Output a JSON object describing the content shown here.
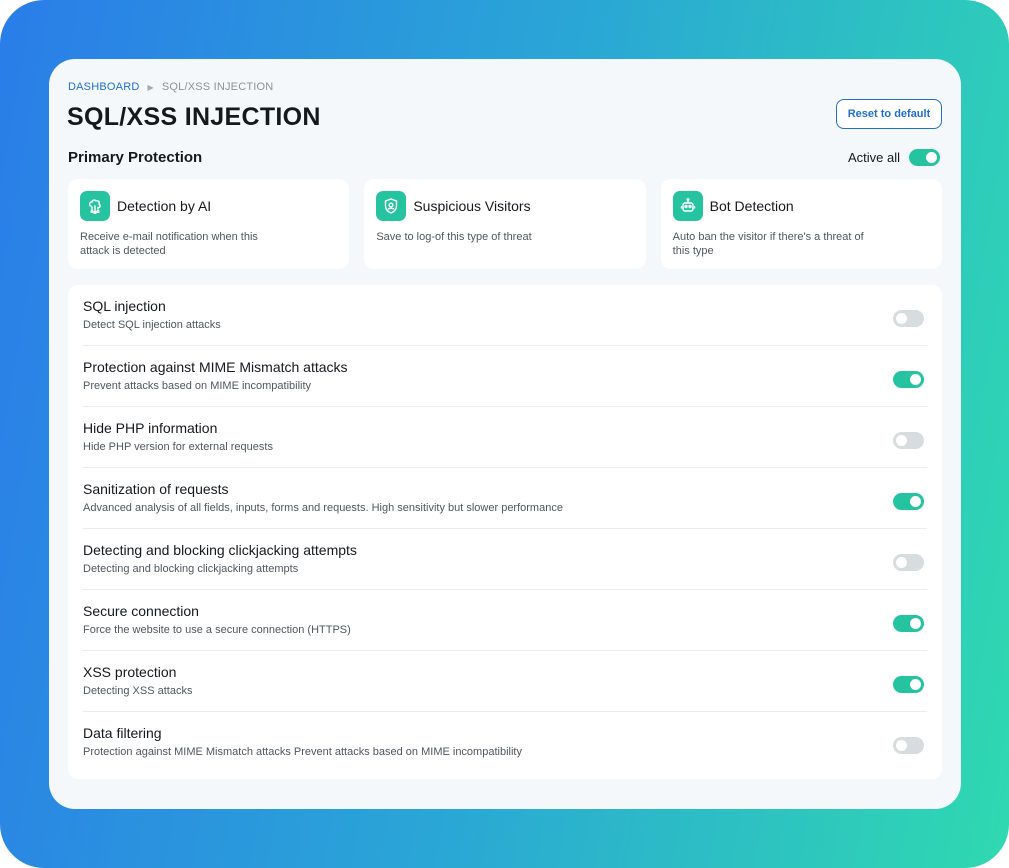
{
  "breadcrumb": {
    "home": "DASHBOARD",
    "current": "SQL/XSS INJECTION"
  },
  "page": {
    "title": "SQL/XSS INJECTION",
    "reset_label": "Reset to default"
  },
  "primary": {
    "title": "Primary Protection",
    "active_all_label": "Active all",
    "active_all_on": true
  },
  "cards": [
    {
      "icon": "ai-brain-icon",
      "title": "Detection by AI",
      "desc": "Receive e-mail notification when this attack is detected"
    },
    {
      "icon": "shield-user-icon",
      "title": "Suspicious Visitors",
      "desc": "Save to log-of this type of threat"
    },
    {
      "icon": "robot-icon",
      "title": "Bot Detection",
      "desc": "Auto ban the visitor if there's a threat of this type"
    }
  ],
  "settings": [
    {
      "title": "SQL injection",
      "desc": "Detect SQL injection attacks",
      "enabled": false
    },
    {
      "title": "Protection against MIME Mismatch attacks",
      "desc": "Prevent attacks based on MIME incompatibility",
      "enabled": true
    },
    {
      "title": "Hide PHP information",
      "desc": "Hide PHP version for external requests",
      "enabled": false
    },
    {
      "title": "Sanitization of requests",
      "desc": "Advanced analysis of all fields, inputs, forms and requests. High sensitivity but slower performance",
      "enabled": true
    },
    {
      "title": "Detecting and blocking clickjacking attempts",
      "desc": "Detecting and blocking clickjacking attempts",
      "enabled": false
    },
    {
      "title": "Secure connection",
      "desc": "Force the website to use a secure connection (HTTPS)",
      "enabled": true
    },
    {
      "title": "XSS protection",
      "desc": "Detecting XSS attacks",
      "enabled": true
    },
    {
      "title": "Data filtering",
      "desc": "Protection against MIME Mismatch attacks Prevent attacks based on MIME incompatibility",
      "enabled": false
    }
  ],
  "colors": {
    "accent": "#26c3a0",
    "link": "#1f6fd1",
    "toggle_off": "#d7dcdf"
  }
}
